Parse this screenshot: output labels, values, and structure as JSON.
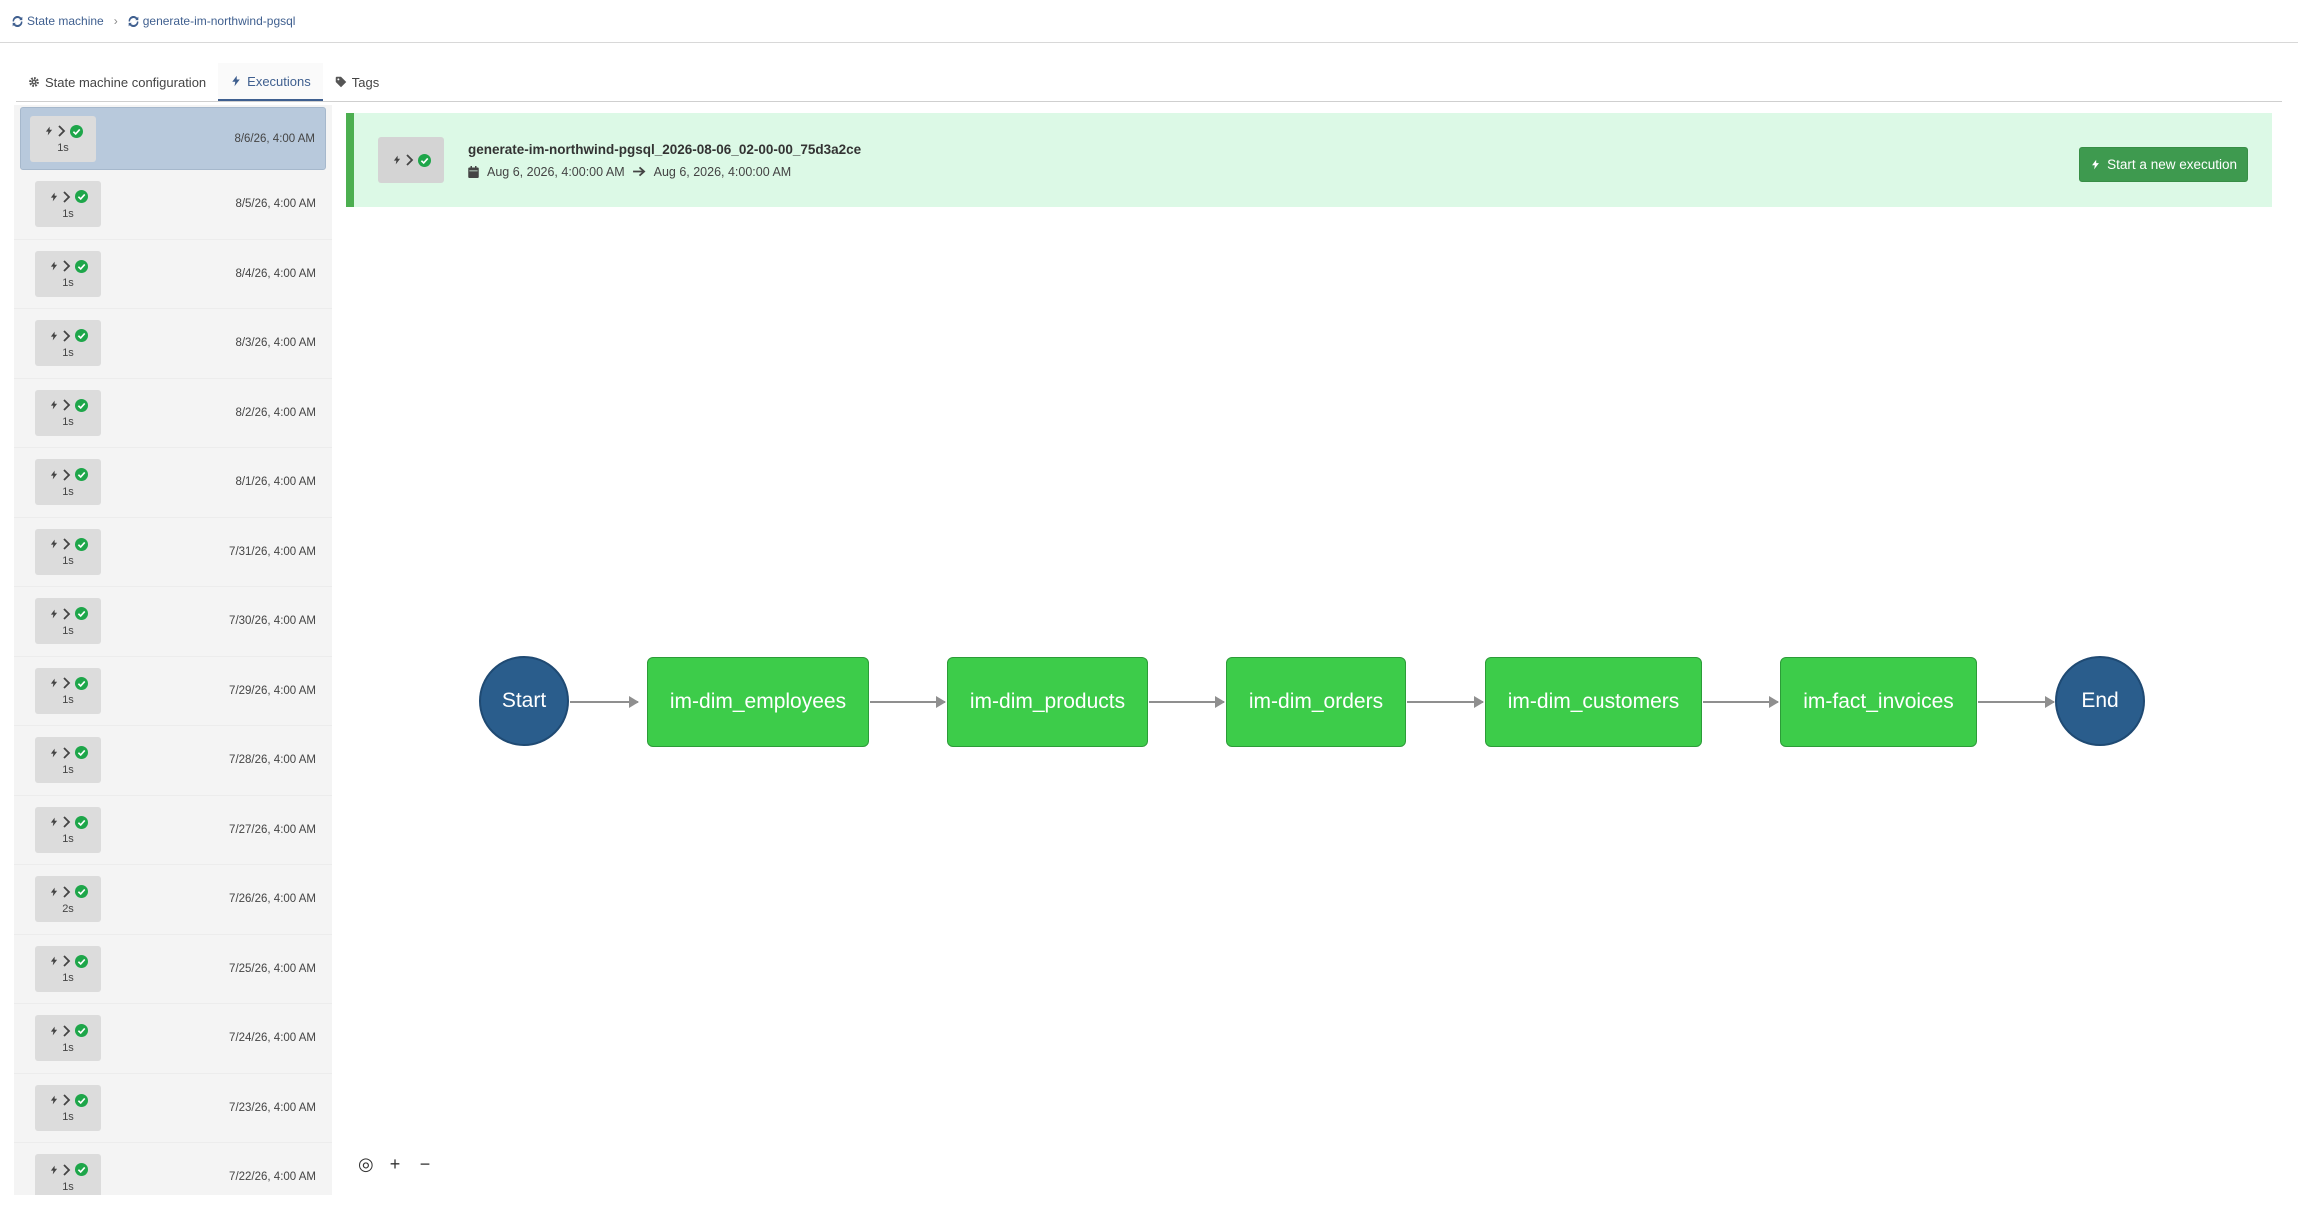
{
  "breadcrumb": {
    "items": [
      {
        "label": "State machine"
      },
      {
        "label": "generate-im-northwind-pgsql"
      }
    ]
  },
  "tabs": [
    {
      "label": "State machine configuration",
      "icon": "gear-icon",
      "active": false
    },
    {
      "label": "Executions",
      "icon": "bolt-icon",
      "active": true
    },
    {
      "label": "Tags",
      "icon": "tag-icon",
      "active": false
    }
  ],
  "executions": [
    {
      "duration": "1s",
      "date": "8/6/26, 4:00 AM",
      "status": "success"
    },
    {
      "duration": "1s",
      "date": "8/5/26, 4:00 AM",
      "status": "success"
    },
    {
      "duration": "1s",
      "date": "8/4/26, 4:00 AM",
      "status": "success"
    },
    {
      "duration": "1s",
      "date": "8/3/26, 4:00 AM",
      "status": "success"
    },
    {
      "duration": "1s",
      "date": "8/2/26, 4:00 AM",
      "status": "success"
    },
    {
      "duration": "1s",
      "date": "8/1/26, 4:00 AM",
      "status": "success"
    },
    {
      "duration": "1s",
      "date": "7/31/26, 4:00 AM",
      "status": "success"
    },
    {
      "duration": "1s",
      "date": "7/30/26, 4:00 AM",
      "status": "success"
    },
    {
      "duration": "1s",
      "date": "7/29/26, 4:00 AM",
      "status": "success"
    },
    {
      "duration": "1s",
      "date": "7/28/26, 4:00 AM",
      "status": "success"
    },
    {
      "duration": "1s",
      "date": "7/27/26, 4:00 AM",
      "status": "success"
    },
    {
      "duration": "2s",
      "date": "7/26/26, 4:00 AM",
      "status": "success"
    },
    {
      "duration": "1s",
      "date": "7/25/26, 4:00 AM",
      "status": "success"
    },
    {
      "duration": "1s",
      "date": "7/24/26, 4:00 AM",
      "status": "success"
    },
    {
      "duration": "1s",
      "date": "7/23/26, 4:00 AM",
      "status": "success"
    },
    {
      "duration": "1s",
      "date": "7/22/26, 4:00 AM",
      "status": "success"
    }
  ],
  "selected_execution": {
    "name": "generate-im-northwind-pgsql_2026-08-06_02-00-00_75d3a2ce",
    "start": "Aug 6, 2026, 4:00:00 AM",
    "end": "Aug 6, 2026, 4:00:00 AM",
    "start_button_label": "Start a new execution"
  },
  "graph": {
    "start_label": "Start",
    "end_label": "End",
    "steps": [
      {
        "label": "im-dim_employees"
      },
      {
        "label": "im-dim_products"
      },
      {
        "label": "im-dim_orders"
      },
      {
        "label": "im-dim_customers"
      },
      {
        "label": "im-fact_invoices"
      }
    ]
  },
  "zoom_controls": {
    "fit": "◎",
    "zoom_in": "+",
    "zoom_out": "−"
  },
  "colors": {
    "accent": "#3f5f8f",
    "success": "#3dcc4a",
    "success_dark": "#3e9a4f",
    "header_bg": "#dcf9e6",
    "terminal_node": "#2a5d8c",
    "selected_row": "#b8c9dc"
  }
}
